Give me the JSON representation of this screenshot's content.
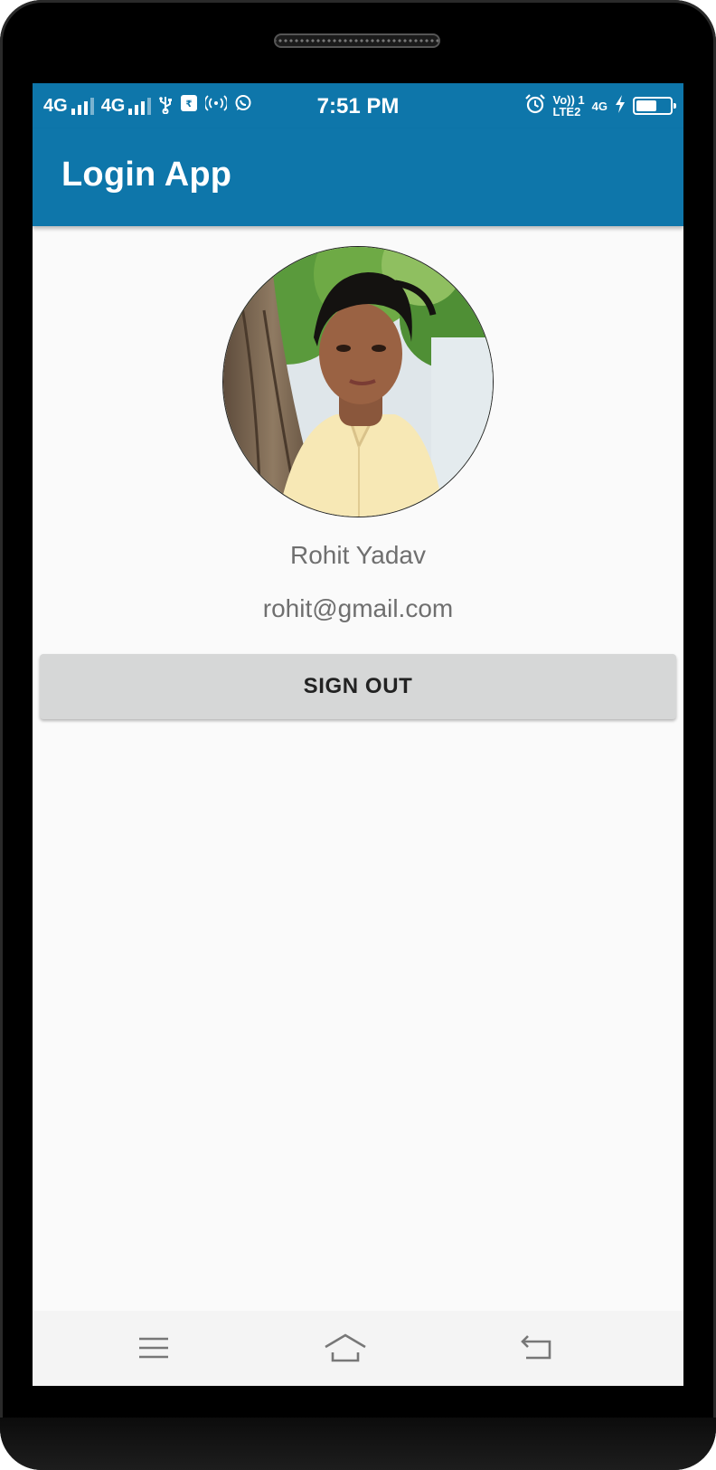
{
  "status_bar": {
    "network_1": "4G",
    "network_2": "4G",
    "time": "7:51 PM",
    "volte_top": "Vo)) 1",
    "volte_bottom": "LTE2",
    "data_type": "4G",
    "battery_level": 0.6,
    "icons": [
      "signal-icon",
      "usb-icon",
      "notification-icon",
      "hotspot-icon",
      "whatsapp-icon",
      "alarm-icon",
      "charging-icon",
      "battery-icon"
    ]
  },
  "app_bar": {
    "title": "Login App",
    "color": "#0e76aa"
  },
  "profile": {
    "name": "Rohit Yadav",
    "email": "rohit@gmail.com"
  },
  "actions": {
    "sign_out_label": "SIGN OUT"
  },
  "nav_bar": {
    "icons": [
      "menu-icon",
      "home-icon",
      "back-icon"
    ]
  }
}
